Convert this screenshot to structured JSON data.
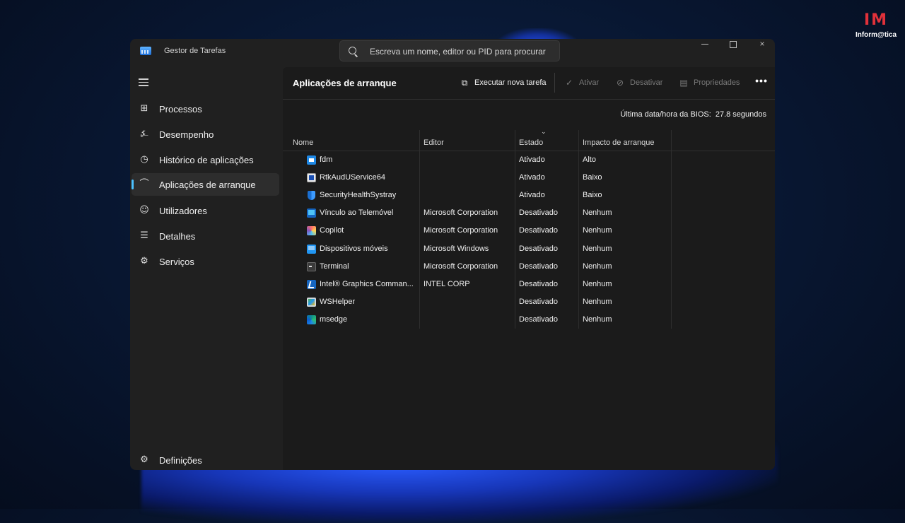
{
  "watermark": {
    "logo": "IM",
    "text": "Inform@tica",
    "color": "#e0313a"
  },
  "window": {
    "title": "Gestor de Tarefas",
    "search_placeholder": "Escreva um nome, editor ou PID para procurar",
    "controls": {
      "minimize": "minimize-icon",
      "maximize": "maximize-icon",
      "close": "×"
    }
  },
  "sidebar": {
    "items": [
      {
        "label": "Processos",
        "icon": "processes-icon"
      },
      {
        "label": "Desempenho",
        "icon": "performance-icon"
      },
      {
        "label": "Histórico de aplicações",
        "icon": "history-icon"
      },
      {
        "label": "Aplicações de arranque",
        "icon": "startup-icon",
        "active": true
      },
      {
        "label": "Utilizadores",
        "icon": "users-icon"
      },
      {
        "label": "Detalhes",
        "icon": "details-icon"
      },
      {
        "label": "Serviços",
        "icon": "services-icon"
      }
    ],
    "settings_label": "Definições"
  },
  "main": {
    "title": "Aplicações de arranque",
    "toolbar": {
      "run_task": "Executar nova tarefa",
      "enable": "Ativar",
      "disable": "Desativar",
      "properties": "Propriedades",
      "more": "•••"
    },
    "bios": {
      "label": "Última data/hora da BIOS:",
      "value": "27.8 segundos"
    },
    "columns": {
      "name": "Nome",
      "editor": "Editor",
      "state": "Estado",
      "impact": "Impacto de arranque"
    },
    "sorted_column": "state",
    "rows": [
      {
        "name": "fdm",
        "editor": "",
        "state": "Ativado",
        "impact": "Alto",
        "icon": "fdm-icon"
      },
      {
        "name": "RtkAudUService64",
        "editor": "",
        "state": "Ativado",
        "impact": "Baixo",
        "icon": "realtek-icon"
      },
      {
        "name": "SecurityHealthSystray",
        "editor": "",
        "state": "Ativado",
        "impact": "Baixo",
        "icon": "shield-icon"
      },
      {
        "name": "Vínculo ao Telemóvel",
        "editor": "Microsoft Corporation",
        "state": "Desativado",
        "impact": "Nenhum",
        "icon": "phone-link-icon"
      },
      {
        "name": "Copilot",
        "editor": "Microsoft Corporation",
        "state": "Desativado",
        "impact": "Nenhum",
        "icon": "copilot-icon"
      },
      {
        "name": "Dispositivos móveis",
        "editor": "Microsoft Windows",
        "state": "Desativado",
        "impact": "Nenhum",
        "icon": "mobile-devices-icon"
      },
      {
        "name": "Terminal",
        "editor": "Microsoft Corporation",
        "state": "Desativado",
        "impact": "Nenhum",
        "icon": "terminal-icon"
      },
      {
        "name": "Intel® Graphics Comman...",
        "editor": "INTEL CORP",
        "state": "Desativado",
        "impact": "Nenhum",
        "icon": "intel-graphics-icon"
      },
      {
        "name": "WSHelper",
        "editor": "",
        "state": "Desativado",
        "impact": "Nenhum",
        "icon": "wshelper-icon"
      },
      {
        "name": "msedge",
        "editor": "",
        "state": "Desativado",
        "impact": "Nenhum",
        "icon": "edge-icon"
      }
    ]
  }
}
